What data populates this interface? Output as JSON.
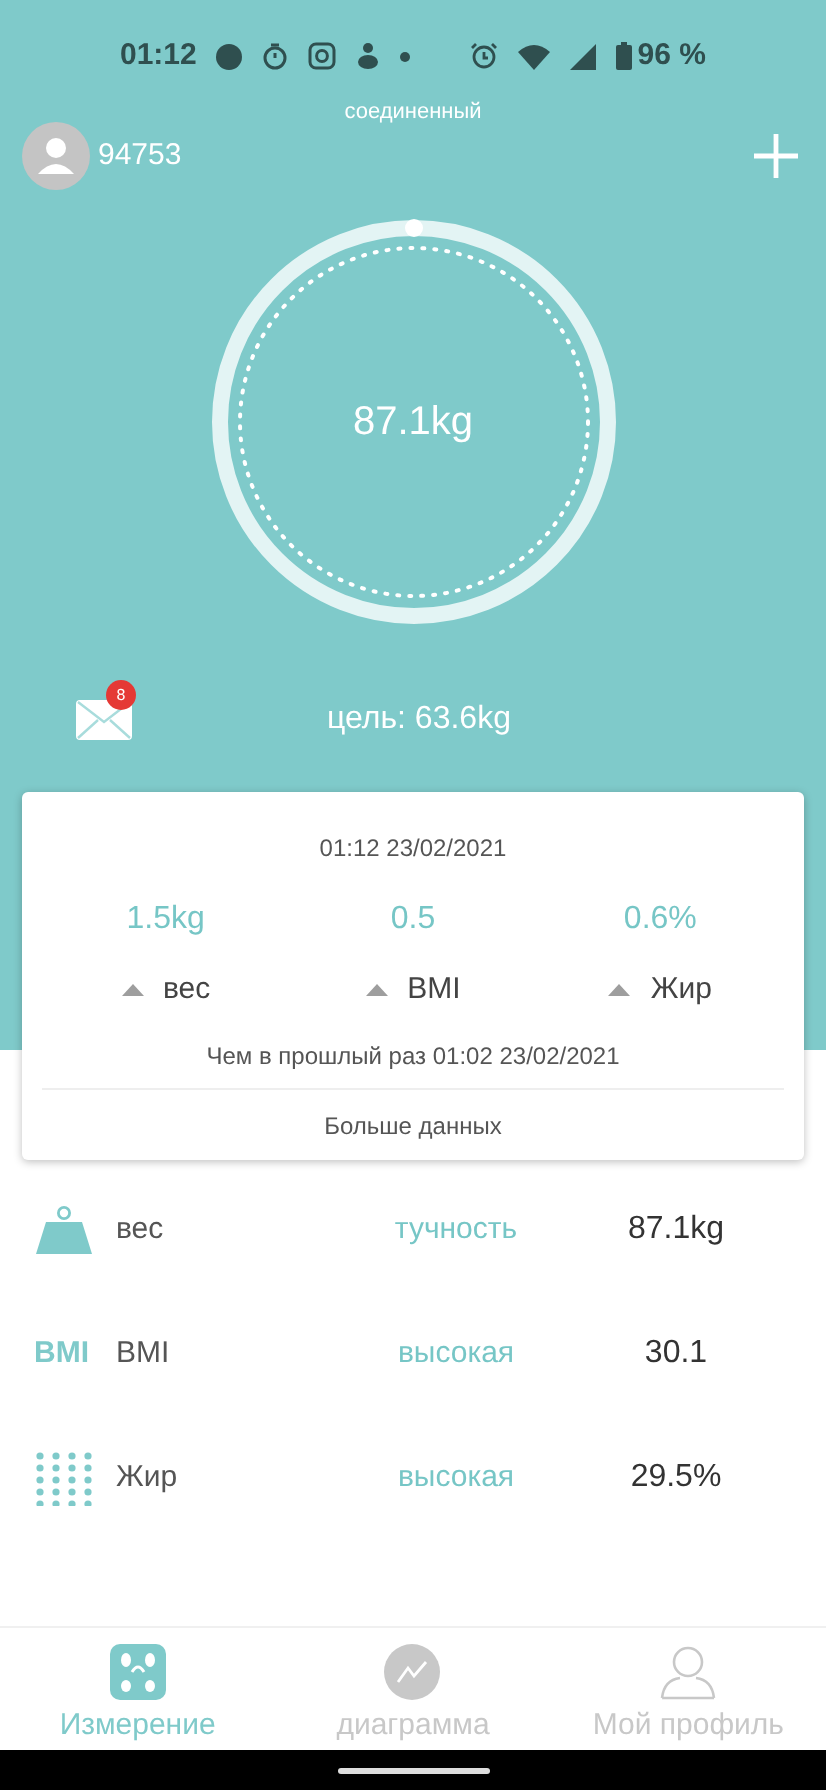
{
  "status_bar": {
    "time": "01:12",
    "battery": "96 %"
  },
  "header": {
    "user_id": "94753",
    "connection": "соединенный"
  },
  "gauge": {
    "weight": "87.1kg"
  },
  "messages": {
    "badge": "8"
  },
  "goal": "цель: 63.6kg",
  "summary": {
    "date": "01:12 23/02/2021",
    "changes": [
      {
        "value": "1.5kg",
        "label": "вес"
      },
      {
        "value": "0.5",
        "label": "BMI"
      },
      {
        "value": "0.6%",
        "label": "Жир"
      }
    ],
    "compared": "Чем в прошлый раз 01:02 23/02/2021",
    "more": "Больше данных"
  },
  "metrics": [
    {
      "kind": "weight",
      "name": "вес",
      "status": "тучность",
      "value": "87.1kg"
    },
    {
      "kind": "bmi",
      "icon_text": "BMI",
      "name": "BMI",
      "status": "высокая",
      "value": "30.1"
    },
    {
      "kind": "fat",
      "name": "Жир",
      "status": "высокая",
      "value": "29.5%"
    }
  ],
  "nav": [
    {
      "kind": "scale",
      "label": "Измерение",
      "selected": true
    },
    {
      "kind": "chart",
      "label": "диаграмма",
      "selected": false
    },
    {
      "kind": "profile",
      "label": "Мой профиль",
      "selected": false
    }
  ]
}
